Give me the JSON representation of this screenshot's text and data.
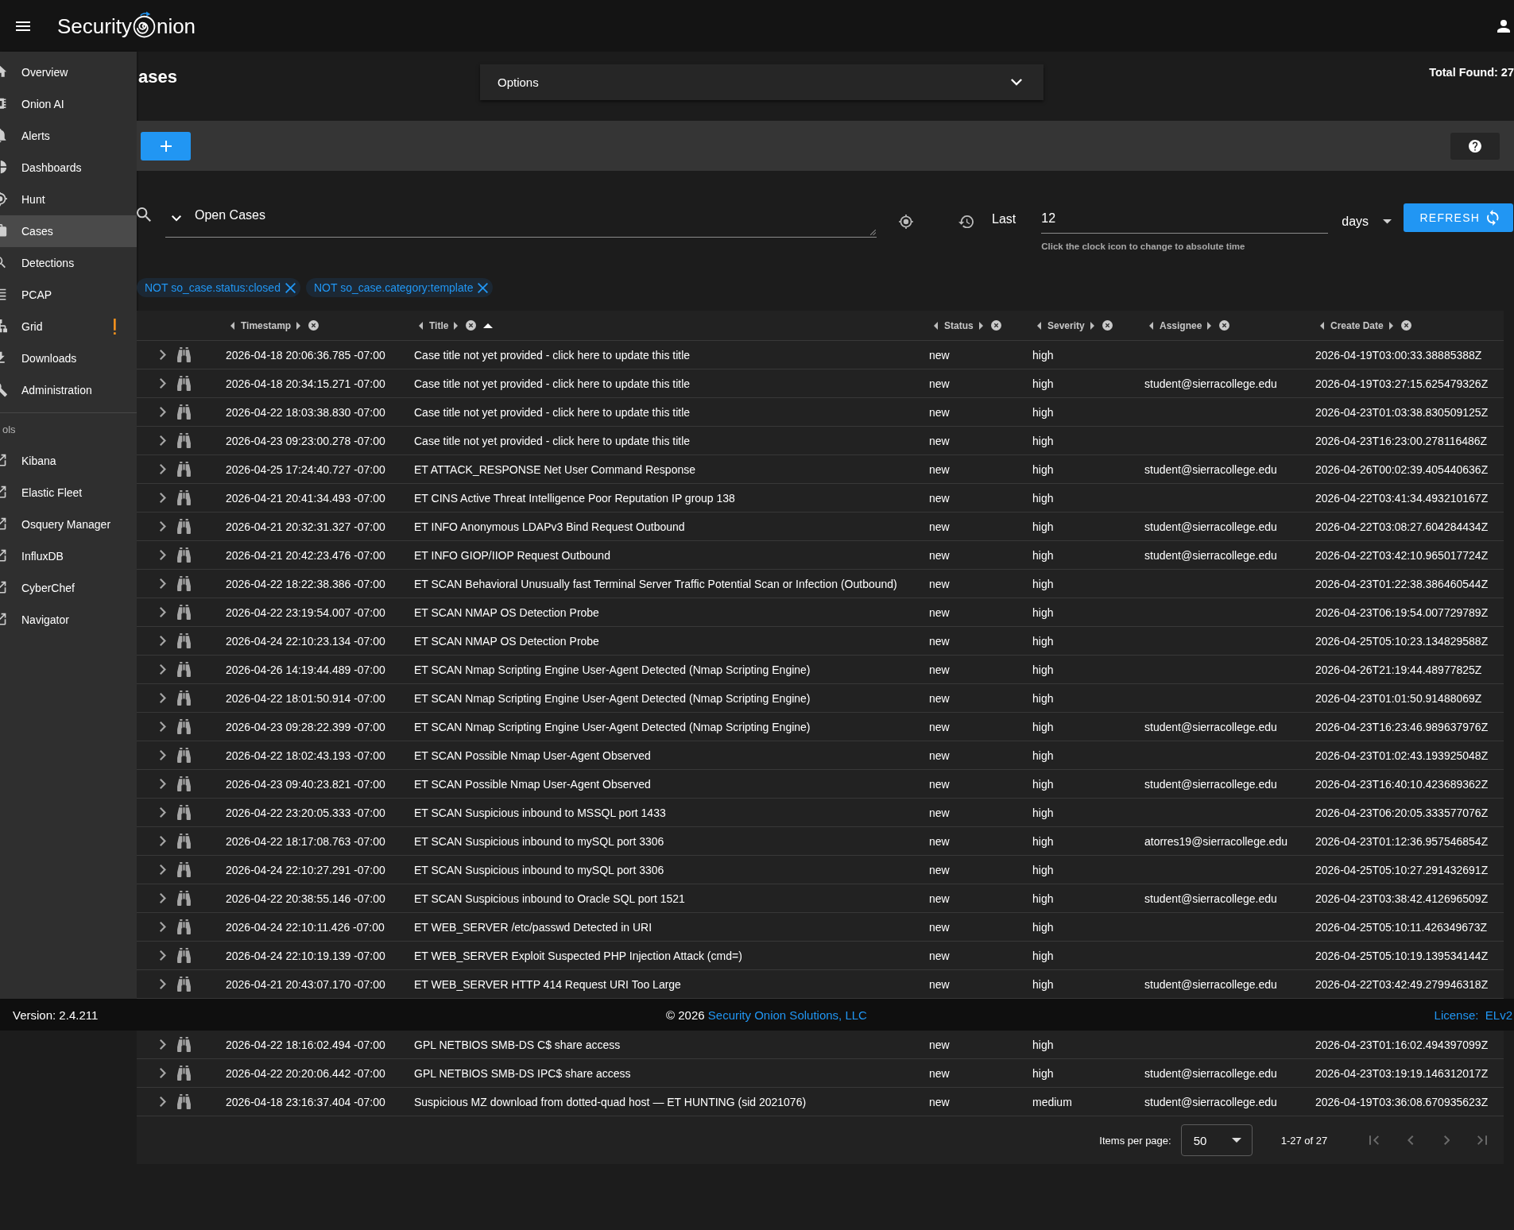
{
  "app_bar": {
    "logo": {
      "before_mark": "Security",
      "after_mark": "nion"
    }
  },
  "nav": {
    "items": [
      {
        "label": "Overview",
        "selected": false,
        "warning": false
      },
      {
        "label": "Onion AI",
        "selected": false,
        "warning": false
      },
      {
        "label": "Alerts",
        "selected": false,
        "warning": false
      },
      {
        "label": "Dashboards",
        "selected": false,
        "warning": false
      },
      {
        "label": "Hunt",
        "selected": false,
        "warning": false
      },
      {
        "label": "Cases",
        "selected": true,
        "warning": false
      },
      {
        "label": "Detections",
        "selected": false,
        "warning": false
      },
      {
        "label": "PCAP",
        "selected": false,
        "warning": false
      },
      {
        "label": "Grid",
        "selected": false,
        "warning": true
      },
      {
        "label": "Downloads",
        "selected": false,
        "warning": false
      },
      {
        "label": "Administration",
        "selected": false,
        "warning": false
      }
    ],
    "tools_heading": "ols",
    "tools": [
      "Kibana",
      "Elastic Fleet",
      "Osquery Manager",
      "InfluxDB",
      "CyberChef",
      "Navigator"
    ]
  },
  "page_head": {
    "title": "ases",
    "options": {
      "label": "Options",
      "expanded": false
    },
    "total_found": "Total Found: 27"
  },
  "query": {
    "value": "Open Cases",
    "range_label": "Last",
    "range_value": "12",
    "range_hint": "Click the clock icon to change to absolute time",
    "range_unit": "days",
    "refresh": "REFRESH",
    "filters": [
      "NOT so_case.status:closed",
      "NOT so_case.category:template"
    ]
  },
  "table": {
    "columns": [
      {
        "label": "Timestamp",
        "sorted": false
      },
      {
        "label": "Title",
        "sorted": true
      },
      {
        "label": "Status",
        "sorted": false
      },
      {
        "label": "Severity",
        "sorted": false
      },
      {
        "label": "Assignee",
        "sorted": false
      },
      {
        "label": "Create Date",
        "sorted": false
      }
    ],
    "rows": [
      {
        "timestamp": "2026-04-18 20:06:36.785 -07:00",
        "title": "Case title not yet provided - click here to update this title",
        "status": "new",
        "severity": "high",
        "create_date": "2026-04-19T03:00:33.38885388Z"
      },
      {
        "timestamp": "2026-04-18 20:34:15.271 -07:00",
        "title": "Case title not yet provided - click here to update this title",
        "status": "new",
        "severity": "high",
        "assignee": "student@sierracollege.edu",
        "create_date": "2026-04-19T03:27:15.625479326Z"
      },
      {
        "timestamp": "2026-04-22 18:03:38.830 -07:00",
        "title": "Case title not yet provided - click here to update this title",
        "status": "new",
        "severity": "high",
        "create_date": "2026-04-23T01:03:38.830509125Z"
      },
      {
        "timestamp": "2026-04-23 09:23:00.278 -07:00",
        "title": "Case title not yet provided - click here to update this title",
        "status": "new",
        "severity": "high",
        "create_date": "2026-04-23T16:23:00.278116486Z"
      },
      {
        "timestamp": "2026-04-25 17:24:40.727 -07:00",
        "title": "ET ATTACK_RESPONSE Net User Command Response",
        "status": "new",
        "severity": "high",
        "assignee": "student@sierracollege.edu",
        "create_date": "2026-04-26T00:02:39.405440636Z"
      },
      {
        "timestamp": "2026-04-21 20:41:34.493 -07:00",
        "title": "ET CINS Active Threat Intelligence Poor Reputation IP group 138",
        "status": "new",
        "severity": "high",
        "create_date": "2026-04-22T03:41:34.493210167Z"
      },
      {
        "timestamp": "2026-04-21 20:32:31.327 -07:00",
        "title": "ET INFO Anonymous LDAPv3 Bind Request Outbound",
        "status": "new",
        "severity": "high",
        "assignee": "student@sierracollege.edu",
        "create_date": "2026-04-22T03:08:27.604284434Z"
      },
      {
        "timestamp": "2026-04-21 20:42:23.476 -07:00",
        "title": "ET INFO GIOP/IIOP Request Outbound",
        "status": "new",
        "severity": "high",
        "assignee": "student@sierracollege.edu",
        "create_date": "2026-04-22T03:42:10.965017724Z"
      },
      {
        "timestamp": "2026-04-22 18:22:38.386 -07:00",
        "title": "ET SCAN Behavioral Unusually fast Terminal Server Traffic Potential Scan or Infection (Outbound)",
        "status": "new",
        "severity": "high",
        "create_date": "2026-04-23T01:22:38.386460544Z"
      },
      {
        "timestamp": "2026-04-22 23:19:54.007 -07:00",
        "title": "ET SCAN NMAP OS Detection Probe",
        "status": "new",
        "severity": "high",
        "create_date": "2026-04-23T06:19:54.007729789Z"
      },
      {
        "timestamp": "2026-04-24 22:10:23.134 -07:00",
        "title": "ET SCAN NMAP OS Detection Probe",
        "status": "new",
        "severity": "high",
        "create_date": "2026-04-25T05:10:23.134829588Z"
      },
      {
        "timestamp": "2026-04-26 14:19:44.489 -07:00",
        "title": "ET SCAN Nmap Scripting Engine User-Agent Detected (Nmap Scripting Engine)",
        "status": "new",
        "severity": "high",
        "create_date": "2026-04-26T21:19:44.48977825Z"
      },
      {
        "timestamp": "2026-04-22 18:01:50.914 -07:00",
        "title": "ET SCAN Nmap Scripting Engine User-Agent Detected (Nmap Scripting Engine)",
        "status": "new",
        "severity": "high",
        "create_date": "2026-04-23T01:01:50.91488069Z"
      },
      {
        "timestamp": "2026-04-23 09:28:22.399 -07:00",
        "title": "ET SCAN Nmap Scripting Engine User-Agent Detected (Nmap Scripting Engine)",
        "status": "new",
        "severity": "high",
        "assignee": "student@sierracollege.edu",
        "create_date": "2026-04-23T16:23:46.989637976Z"
      },
      {
        "timestamp": "2026-04-22 18:02:43.193 -07:00",
        "title": "ET SCAN Possible Nmap User-Agent Observed",
        "status": "new",
        "severity": "high",
        "create_date": "2026-04-23T01:02:43.193925048Z"
      },
      {
        "timestamp": "2026-04-23 09:40:23.821 -07:00",
        "title": "ET SCAN Possible Nmap User-Agent Observed",
        "status": "new",
        "severity": "high",
        "assignee": "student@sierracollege.edu",
        "create_date": "2026-04-23T16:40:10.423689362Z"
      },
      {
        "timestamp": "2026-04-22 23:20:05.333 -07:00",
        "title": "ET SCAN Suspicious inbound to MSSQL port 1433",
        "status": "new",
        "severity": "high",
        "create_date": "2026-04-23T06:20:05.333577076Z"
      },
      {
        "timestamp": "2026-04-22 18:17:08.763 -07:00",
        "title": "ET SCAN Suspicious inbound to mySQL port 3306",
        "status": "new",
        "severity": "high",
        "assignee": "atorres19@sierracollege.edu",
        "create_date": "2026-04-23T01:12:36.957546854Z"
      },
      {
        "timestamp": "2026-04-24 22:10:27.291 -07:00",
        "title": "ET SCAN Suspicious inbound to mySQL port 3306",
        "status": "new",
        "severity": "high",
        "create_date": "2026-04-25T05:10:27.291432691Z"
      },
      {
        "timestamp": "2026-04-22 20:38:55.146 -07:00",
        "title": "ET SCAN Suspicious inbound to Oracle SQL port 1521",
        "status": "new",
        "severity": "high",
        "assignee": "student@sierracollege.edu",
        "create_date": "2026-04-23T03:38:42.412696509Z"
      },
      {
        "timestamp": "2026-04-24 22:10:11.426 -07:00",
        "title": "ET WEB_SERVER /etc/passwd Detected in URI",
        "status": "new",
        "severity": "high",
        "create_date": "2026-04-25T05:10:11.426349673Z"
      },
      {
        "timestamp": "2026-04-24 22:10:19.139 -07:00",
        "title": "ET WEB_SERVER Exploit Suspected PHP Injection Attack (cmd=)",
        "status": "new",
        "severity": "high",
        "create_date": "2026-04-25T05:10:19.139534144Z"
      },
      {
        "timestamp": "2026-04-21 20:43:07.170 -07:00",
        "title": "ET WEB_SERVER HTTP 414 Request URI Too Large",
        "status": "new",
        "severity": "high",
        "assignee": "student@sierracollege.edu",
        "create_date": "2026-04-22T03:42:49.279946318Z"
      }
    ]
  },
  "footer": {
    "version": "Version: 2.4.211",
    "copyright": "© 2026",
    "company_link": "Security Onion Solutions, LLC",
    "license": "License:  ELv2"
  },
  "table_below_footer": {
    "rows": [
      {
        "timestamp": "2026-04-22 18:16:02.494 -07:00",
        "title": "GPL NETBIOS SMB-DS C$ share access",
        "status": "new",
        "severity": "high",
        "create_date": "2026-04-23T01:16:02.494397099Z"
      },
      {
        "timestamp": "2026-04-22 20:20:06.442 -07:00",
        "title": "GPL NETBIOS SMB-DS IPC$ share access",
        "status": "new",
        "severity": "high",
        "assignee": "student@sierracollege.edu",
        "create_date": "2026-04-23T03:19:19.146312017Z"
      },
      {
        "timestamp": "2026-04-18 23:16:37.404 -07:00",
        "title": "Suspicious MZ download from dotted-quad host — ET HUNTING (sid 2021076)",
        "status": "new",
        "severity": "medium",
        "assignee": "student@sierracollege.edu",
        "create_date": "2026-04-19T03:36:08.670935623Z"
      }
    ]
  },
  "pagination": {
    "items_per_page_label": "Items per page:",
    "items_per_page": "50",
    "range": "1-27 of 27",
    "buttons": [
      {
        "disabled": true
      },
      {
        "disabled": true
      },
      {
        "disabled": true
      },
      {
        "disabled": true
      }
    ]
  }
}
